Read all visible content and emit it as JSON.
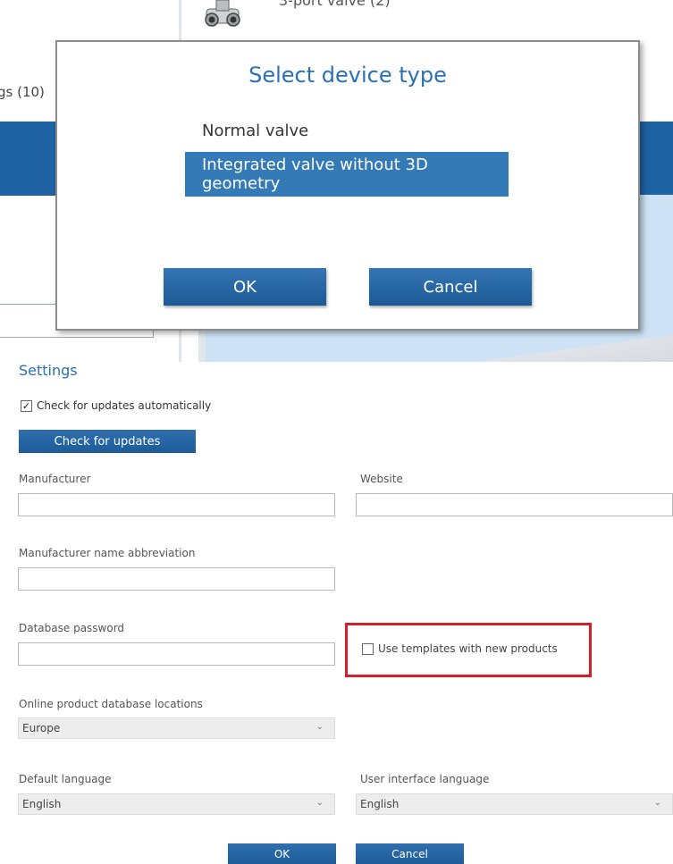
{
  "background": {
    "valve_label": "3-port valve (2)",
    "category_label": "gs (10)"
  },
  "modal": {
    "title": "Select device type",
    "options": [
      {
        "label": "Normal valve",
        "selected": false
      },
      {
        "label": "Integrated valve without 3D geometry",
        "selected": true
      }
    ],
    "ok_label": "OK",
    "cancel_label": "Cancel"
  },
  "settings": {
    "title": "Settings",
    "auto_update": {
      "label": "Check for updates automatically",
      "checked": true
    },
    "check_button": "Check for updates",
    "manufacturer": {
      "label": "Manufacturer",
      "value": ""
    },
    "website": {
      "label": "Website",
      "value": ""
    },
    "abbreviation": {
      "label": "Manufacturer name abbreviation",
      "value": ""
    },
    "db_password": {
      "label": "Database password",
      "value": ""
    },
    "use_templates": {
      "label": "Use templates with new products",
      "checked": false
    },
    "db_location": {
      "label": "Online product database locations",
      "value": "Europe"
    },
    "default_language": {
      "label": "Default language",
      "value": "English"
    },
    "ui_language": {
      "label": "User interface language",
      "value": "English"
    },
    "ok_label": "OK",
    "cancel_label": "Cancel"
  },
  "colors": {
    "accent": "#2a70b4",
    "button": "#1e62a3",
    "selected": "#337ab7",
    "highlight": "#d4202a"
  },
  "icons": {
    "valve": "three-port-valve-icon",
    "checkbox_checked": "✓",
    "chevron": "⌄"
  }
}
